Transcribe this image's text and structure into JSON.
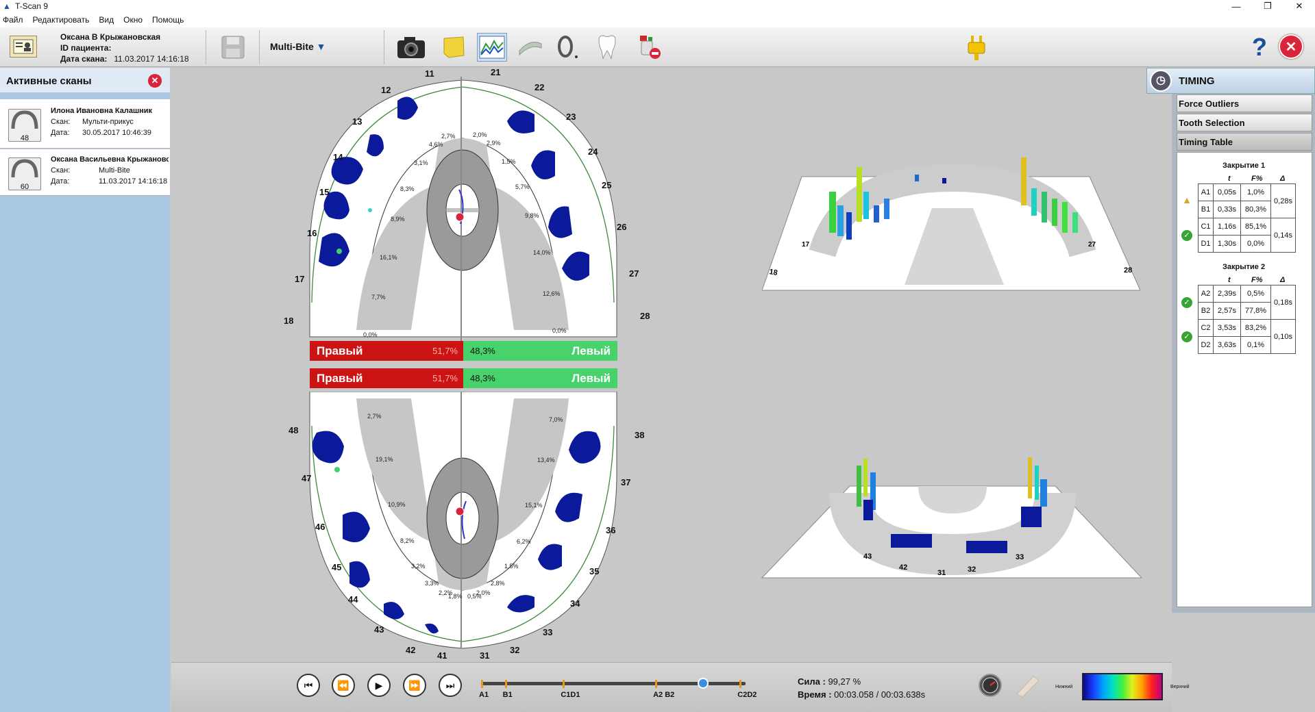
{
  "window": {
    "title": "T-Scan 9",
    "buttons": [
      "—",
      "❐",
      "✕"
    ]
  },
  "menu": [
    "Файл",
    "Редактировать",
    "Вид",
    "Окно",
    "Помощь"
  ],
  "patient": {
    "name": "Оксана В Крыжановская",
    "id_label": "ID пациента:",
    "id_value": "",
    "date_label": "Дата скана:",
    "date_value": "11.03.2017 14:16:18"
  },
  "toolbar": {
    "mode_label": "Multi-Bite",
    "help_label": "?",
    "close_label": "✕"
  },
  "active_scans": {
    "title": "Активные сканы",
    "scans": [
      {
        "name": "Илона Ивановна Калашник",
        "badge": "48",
        "scan_label": "Скан:",
        "scan_value": "Мульти-прикус",
        "date_label": "Дата:",
        "date_value": "30.05.2017 10:46:39"
      },
      {
        "name": "Оксана Васильевна Крыжановская",
        "badge": "60",
        "scan_label": "Скан:",
        "scan_value": "Multi-Bite",
        "date_label": "Дата:",
        "date_value": "11.03.2017 14:16:18"
      }
    ]
  },
  "upper_arch": {
    "teeth": [
      "11",
      "12",
      "13",
      "14",
      "15",
      "16",
      "17",
      "18",
      "21",
      "22",
      "23",
      "24",
      "25",
      "26",
      "27",
      "28"
    ],
    "right_percents": [
      "2,7%",
      "4,6%",
      "3,1%",
      "8,3%",
      "8,9%",
      "16,1%",
      "7,7%",
      "0,0%"
    ],
    "left_percents": [
      "2,0%",
      "2,9%",
      "1,5%",
      "5,7%",
      "9,8%",
      "14,0%",
      "12,6%",
      "0,0%"
    ],
    "balance": {
      "right_label": "Правый",
      "right_value": "51,7%",
      "left_value": "48,3%",
      "left_label": "Левый"
    }
  },
  "lower_arch": {
    "teeth": [
      "48",
      "47",
      "46",
      "45",
      "44",
      "43",
      "42",
      "41",
      "31",
      "32",
      "33",
      "34",
      "35",
      "36",
      "37",
      "38"
    ],
    "right_percents": [
      "2,7%",
      "19,1%",
      "10,9%",
      "8,2%",
      "3,2%",
      "3,3%",
      "2,2%",
      "1,8%"
    ],
    "left_percents": [
      "7,0%",
      "13,4%",
      "15,1%",
      "6,2%",
      "1,5%",
      "2,8%",
      "2,0%",
      "0,5%"
    ],
    "balance": {
      "right_label": "Правый",
      "right_value": "51,7%",
      "left_value": "48,3%",
      "left_label": "Левый"
    }
  },
  "view3d": {
    "upper_labels": [
      "18",
      "17",
      "27",
      "28"
    ],
    "lower_labels": [
      "43",
      "42",
      "31",
      "32",
      "33"
    ]
  },
  "timing": {
    "title": "TIMING",
    "tabs": [
      "Force Outliers",
      "Tooth Selection",
      "Timing Table"
    ],
    "columns": [
      "t",
      "F%",
      "Δ"
    ],
    "groups": [
      {
        "title": "Закрытие 1",
        "rows": [
          {
            "id": "A1",
            "t": "0,05s",
            "f": "1,0%"
          },
          {
            "id": "B1",
            "t": "0,33s",
            "f": "80,3%"
          },
          {
            "id": "C1",
            "t": "1,16s",
            "f": "85,1%"
          },
          {
            "id": "D1",
            "t": "1,30s",
            "f": "0,0%"
          }
        ],
        "deltas": [
          "0,28s",
          "0,14s"
        ],
        "status": [
          "warn",
          "ok"
        ]
      },
      {
        "title": "Закрытие 2",
        "rows": [
          {
            "id": "A2",
            "t": "2,39s",
            "f": "0,5%"
          },
          {
            "id": "B2",
            "t": "2,57s",
            "f": "77,8%"
          },
          {
            "id": "C2",
            "t": "3,53s",
            "f": "83,2%"
          },
          {
            "id": "D2",
            "t": "3,63s",
            "f": "0,1%"
          }
        ],
        "deltas": [
          "0,18s",
          "0,10s"
        ],
        "status": [
          "ok",
          "ok"
        ]
      }
    ]
  },
  "playback": {
    "markers": [
      "A1",
      "B1",
      "C1D1",
      "A2 B2",
      "C2D2"
    ],
    "marker_positions": [
      0.0,
      0.09,
      0.31,
      0.66,
      0.98
    ],
    "playhead": 0.84,
    "force_label": "Сила :",
    "force_value": "99,27 %",
    "time_label": "Время :",
    "time_value": "00:03.058 / 00:03.638s",
    "scale_low": "Нижний",
    "scale_high": "Верхний"
  }
}
